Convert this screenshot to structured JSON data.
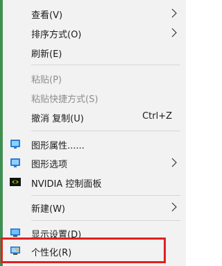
{
  "menu": {
    "view": "查看(V)",
    "sort": "排序方式(O)",
    "refresh": "刷新(E)",
    "paste": "粘贴(P)",
    "paste_shortcut": "粘贴快捷方式(S)",
    "undo_copy": "撤消 复制(U)",
    "undo_shortcut": "Ctrl+Z",
    "graphics_properties": "图形属性......",
    "graphics_options": "图形选项",
    "nvidia": "NVIDIA 控制面板",
    "new": "新建(W)",
    "display_settings": "显示设置(D)",
    "personalize": "个性化(R)"
  },
  "icons": {
    "graphics_properties": "intel-graphics-icon",
    "graphics_options": "intel-graphics-icon",
    "nvidia": "nvidia-icon",
    "display_settings": "display-monitor-icon",
    "personalize": "personalize-monitor-icon"
  },
  "colors": {
    "menu_bg": "#f2f2f2",
    "highlight_border": "#e02020",
    "left_edge": "#3f8f52"
  }
}
